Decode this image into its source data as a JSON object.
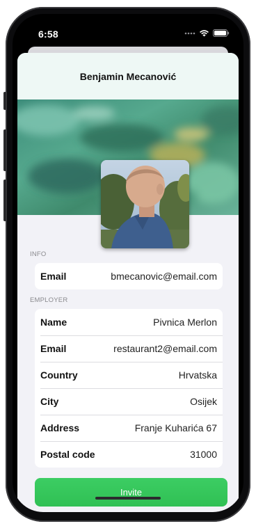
{
  "status_bar": {
    "time": "6:58",
    "icons": [
      "signal-dots-icon",
      "wifi-icon",
      "battery-icon"
    ]
  },
  "nav": {
    "title": "Benjamin Mecanović"
  },
  "profile": {
    "cover_image": "abstract-green-texture",
    "avatar": "profile-photo"
  },
  "info": {
    "header": "INFO",
    "rows": [
      {
        "label": "Email",
        "value": "bmecanovic@email.com"
      }
    ]
  },
  "employer": {
    "header": "EMPLOYER",
    "rows": [
      {
        "label": "Name",
        "value": "Pivnica Merlon"
      },
      {
        "label": "Email",
        "value": "restaurant2@email.com"
      },
      {
        "label": "Country",
        "value": "Hrvatska"
      },
      {
        "label": "City",
        "value": "Osijek"
      },
      {
        "label": "Address",
        "value": "Franje Kuharića 67"
      },
      {
        "label": "Postal code",
        "value": "31000"
      }
    ]
  },
  "actions": {
    "invite_label": "Invite"
  },
  "colors": {
    "accent_green": "#34c759",
    "nav_background": "#eef8f5",
    "grouped_background": "#f2f2f7"
  }
}
